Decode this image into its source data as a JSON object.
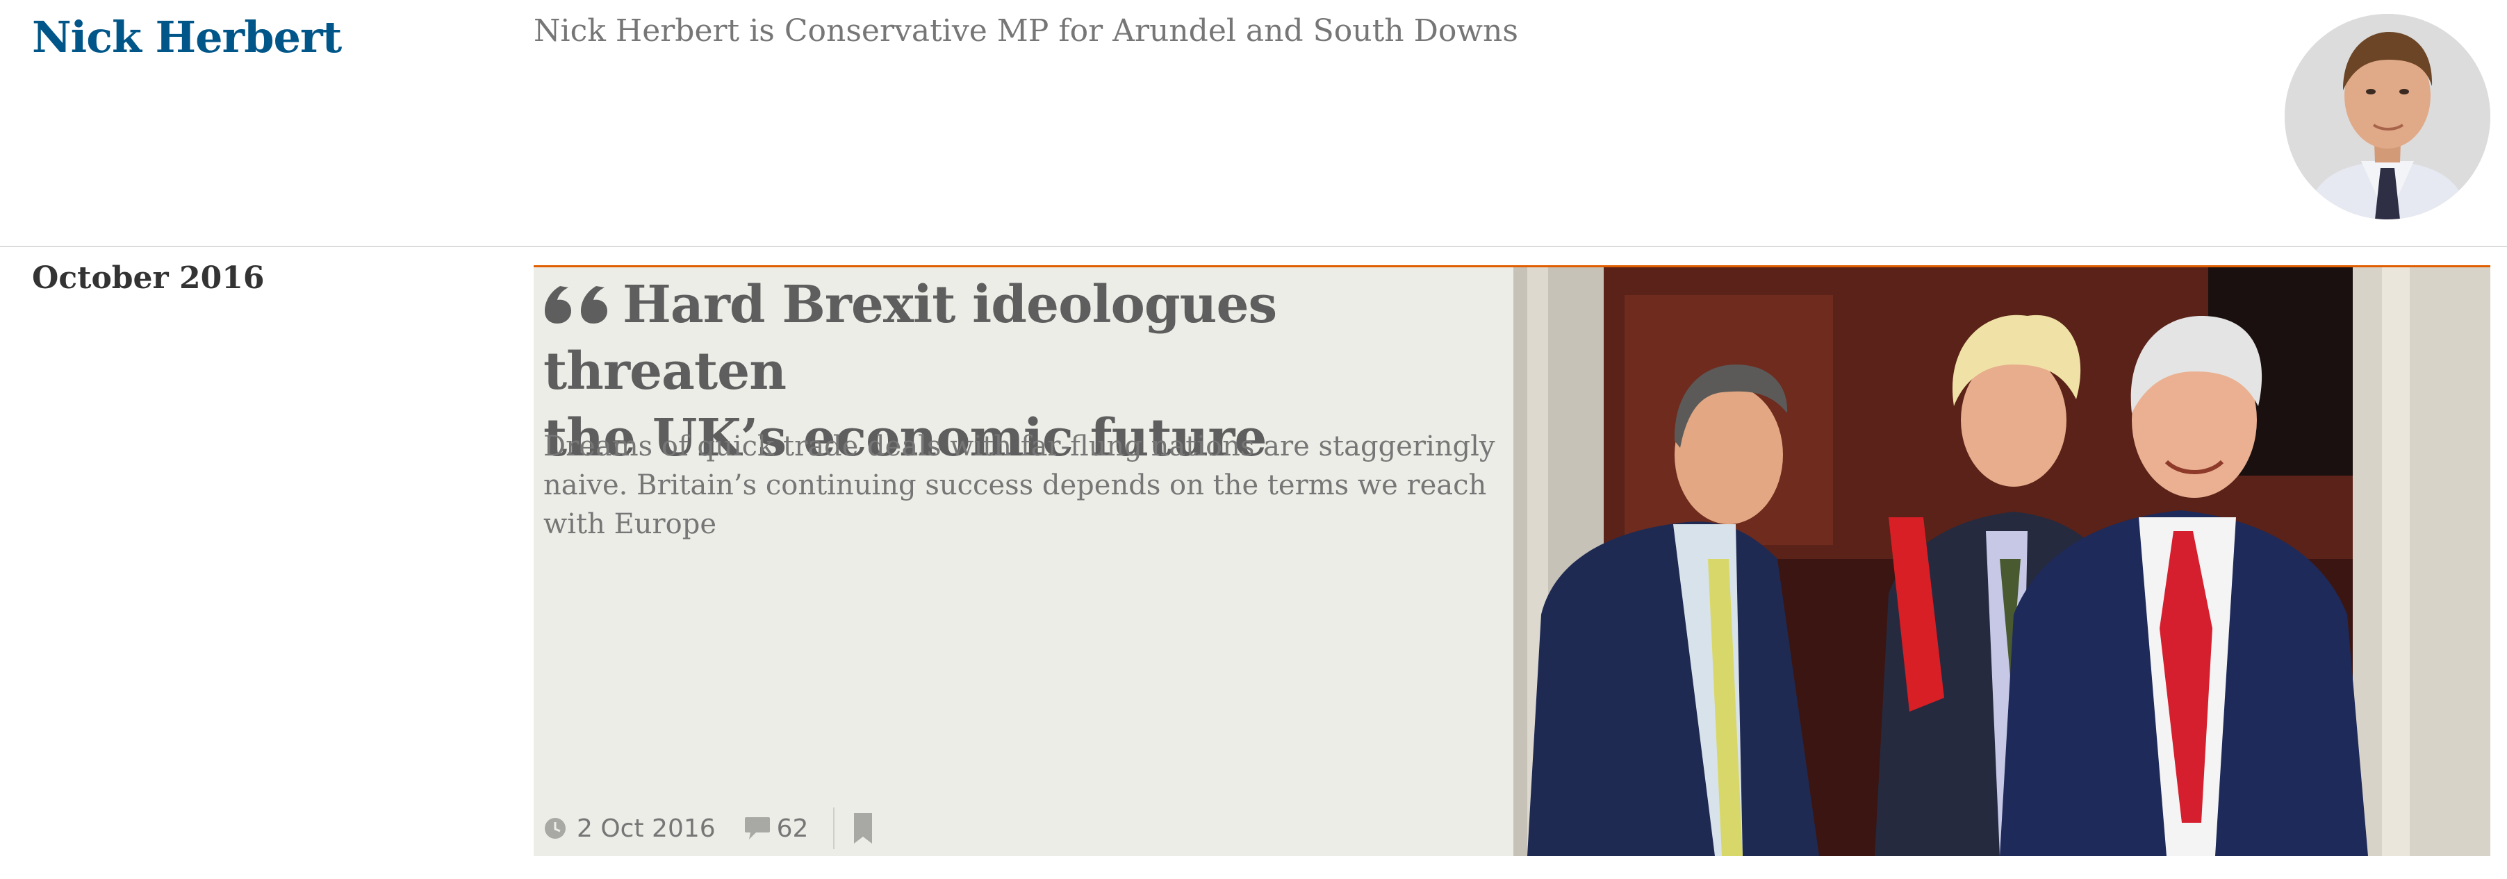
{
  "profile": {
    "name": "Nick Herbert",
    "bio": "Nick Herbert is Conservative MP for Arundel and South Downs"
  },
  "archive": {
    "month": "October 2016"
  },
  "article": {
    "headline_line1": "Hard Brexit ideologues threaten",
    "headline_line2": "the UK’s economic future",
    "standfirst": "Dreams of quick trade deals with far-flung nations are staggeringly naive. Britain’s continuing success depends on the terms we reach with Europe",
    "date": "2 Oct 2016",
    "comment_count": "62",
    "icons": {
      "quote": "quote-icon",
      "clock": "clock-icon",
      "comments": "comment-icon",
      "save": "bookmark-icon"
    }
  },
  "colors": {
    "brand_blue": "#005689",
    "opinion_accent": "#e05e00",
    "card_background": "#edede8",
    "headline_grey": "#5e5e5e",
    "meta_grey": "#767676"
  }
}
